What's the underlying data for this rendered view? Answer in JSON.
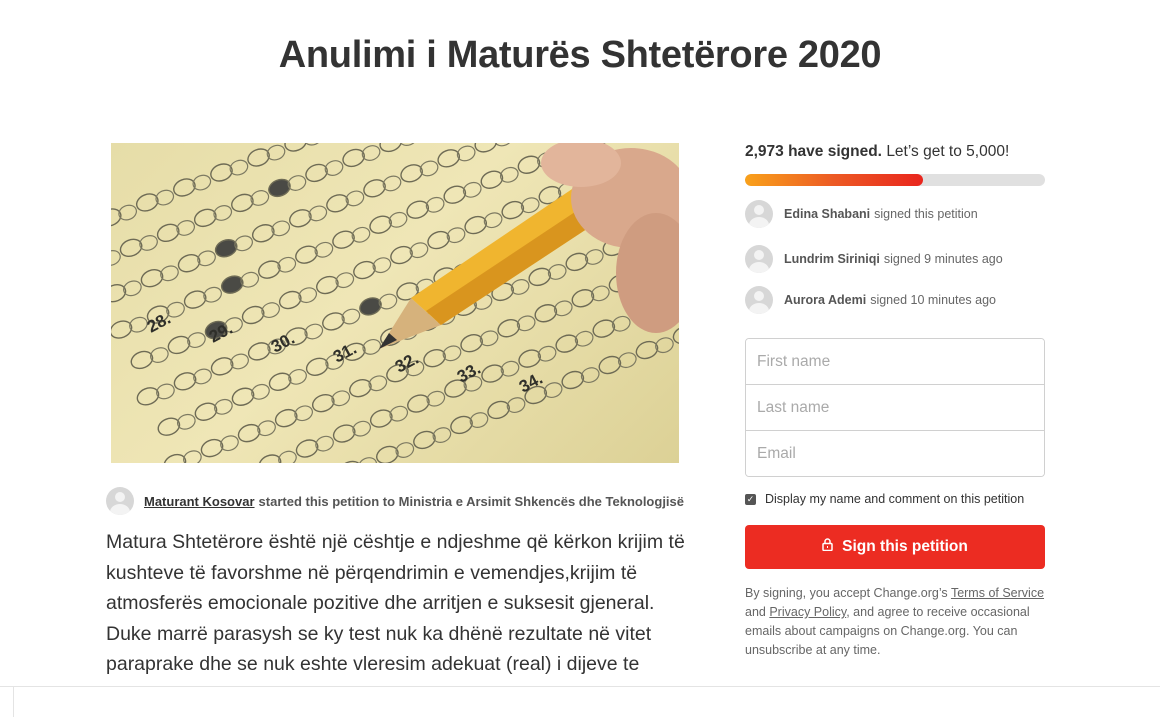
{
  "page_title": "Anulimi i Maturës Shtetërore 2020",
  "starter": {
    "name": "Maturant Kosovar",
    "text": "started this petition to Ministria e Arsimit Shkencës dhe Teknologjisë"
  },
  "description": "Matura Shtetërore është një cështje e ndjeshme që kërkon krijim të kushteve të favorshme në përqendrimin e vemendjes,krijim të atmosferës emocionale pozitive dhe arritjen e suksesit gjeneral. Duke marrë parasysh se ky test nuk ka dhënë rezultate në vitet paraprake dhe se nuk eshte vleresim adekuat (real) i dijeve te nxenesve sepse kryesisht është i bazuar ne kopjim",
  "signatures": {
    "count_label": "2,973 have signed.",
    "goal_label": "Let’s get to 5,000!",
    "count": 2973,
    "goal": 5000
  },
  "recent_signers": [
    {
      "name": "Edina Shabani",
      "action": "signed this petition"
    },
    {
      "name": "Lundrim Siriniqi",
      "action": "signed 9 minutes ago"
    },
    {
      "name": "Aurora Ademi",
      "action": "signed 10 minutes ago"
    }
  ],
  "form": {
    "first_name_placeholder": "First name",
    "last_name_placeholder": "Last name",
    "email_placeholder": "Email",
    "consent_label": "Display my name and comment on this petition",
    "consent_checked": true
  },
  "sign_button": {
    "label": "Sign this petition",
    "icon": "lock-icon"
  },
  "terms": {
    "prefix": "By signing, you accept Change.org’s",
    "terms_link": "Terms of Service",
    "and": "and",
    "privacy_link": "Privacy Policy",
    "suffix": ", and agree to receive occasional emails about campaigns on Change.org. You can unsubscribe at any time."
  },
  "hero_image": {
    "icon": "exam-answer-sheet-pencil-image",
    "question_numbers": [
      "28.",
      "29.",
      "30.",
      "31.",
      "32.",
      "33.",
      "34."
    ]
  },
  "colors": {
    "accent": "#ec2c22",
    "progress_start": "#f9a11b",
    "progress_end": "#e9251d",
    "text": "#333333"
  }
}
